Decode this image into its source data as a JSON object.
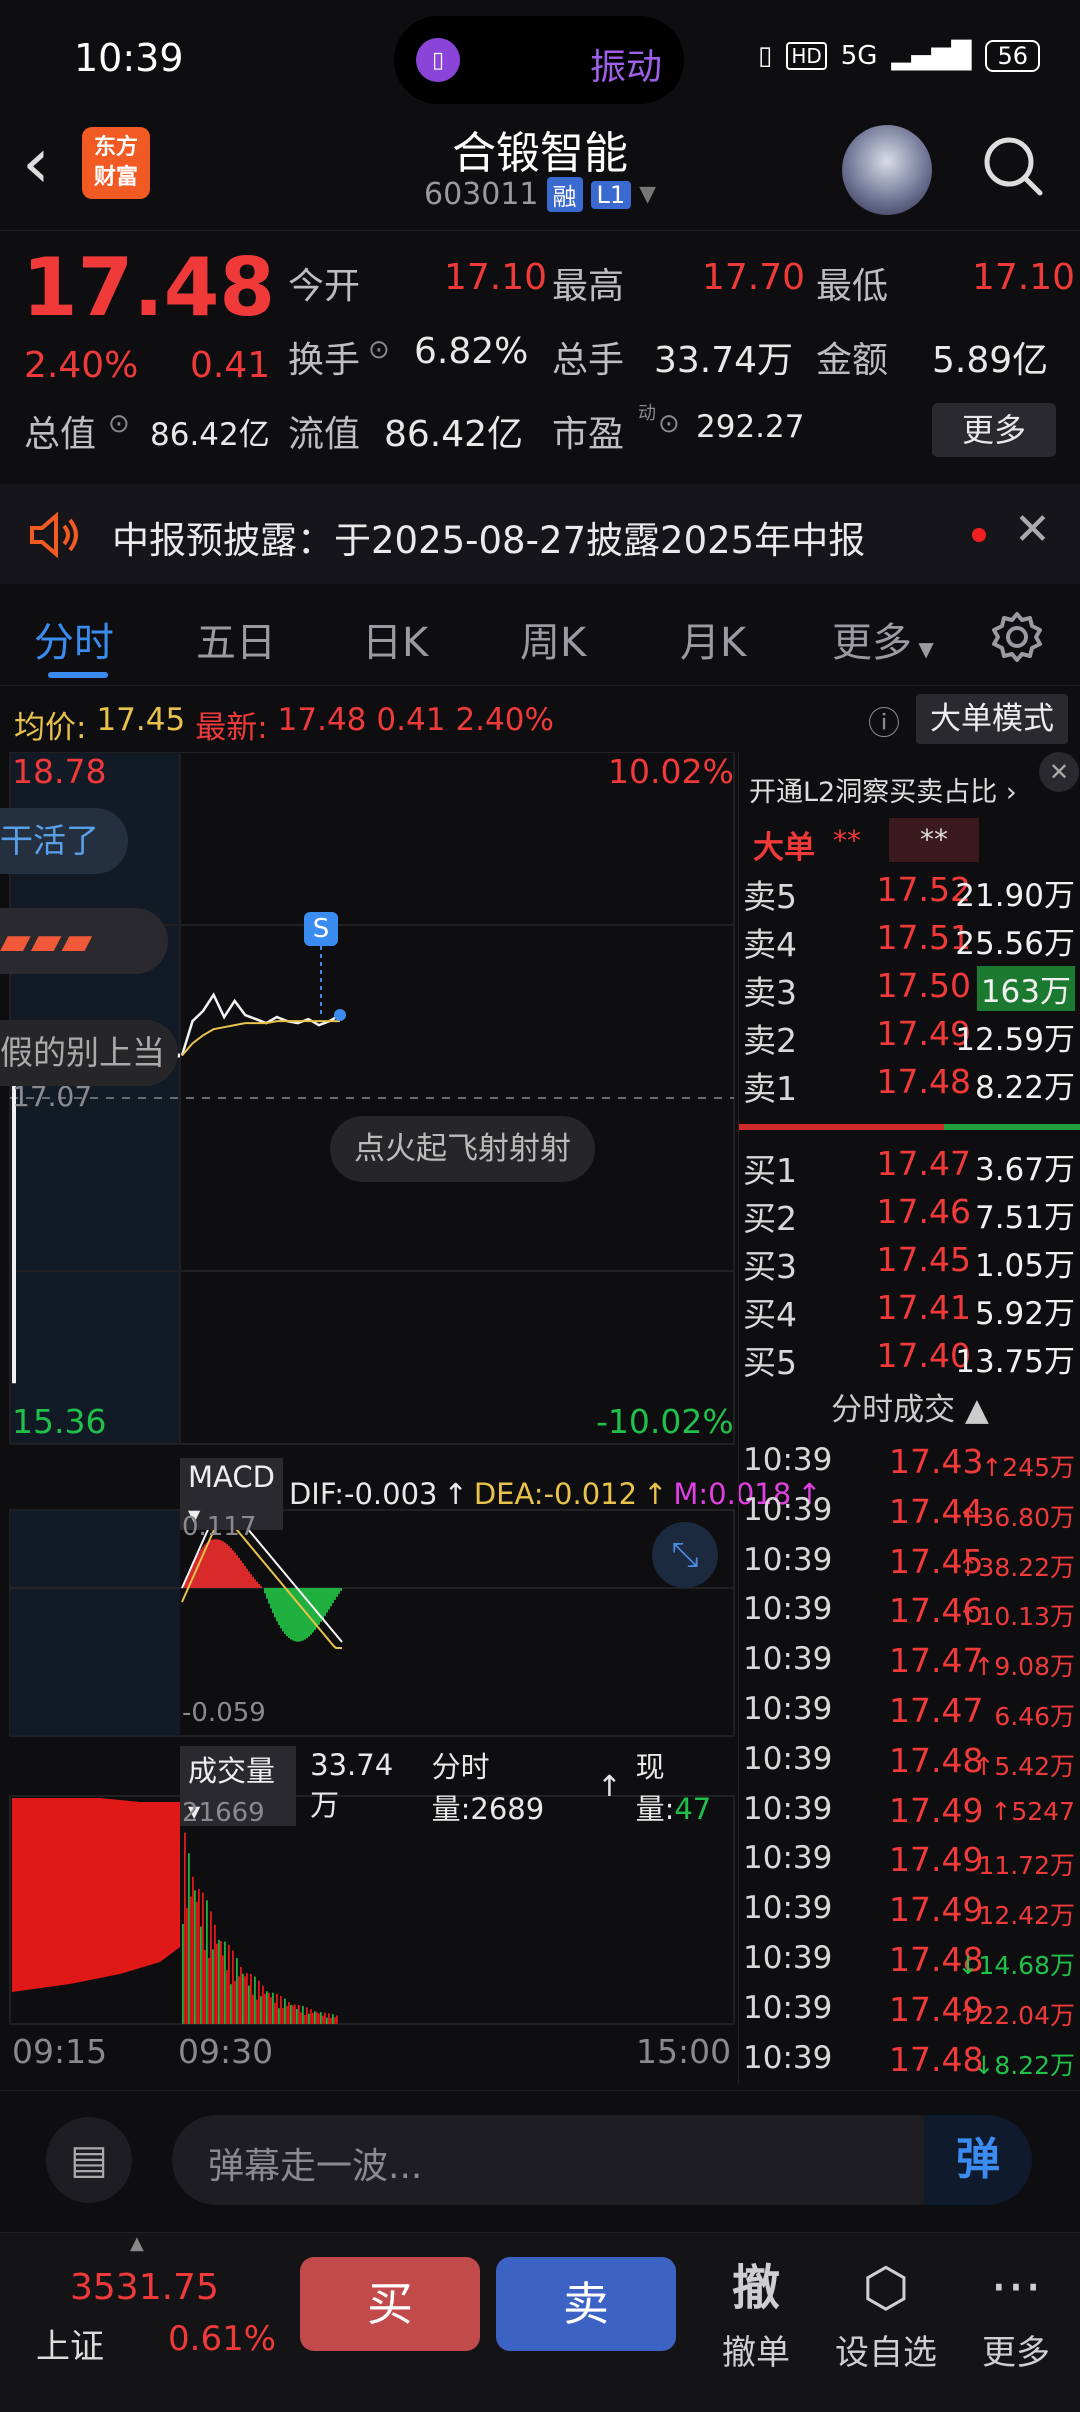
{
  "status": {
    "time": "10:39",
    "vibrate": "振动",
    "network": "5G",
    "battery": "56"
  },
  "header": {
    "logo_line1": "东方",
    "logo_line2": "财富",
    "name": "合锻智能",
    "code": "603011",
    "tag_margin": "融",
    "tag_level": "L1"
  },
  "quote": {
    "price": "17.48",
    "pct": "2.40%",
    "change": "0.41",
    "open_label": "今开",
    "open": "17.10",
    "high_label": "最高",
    "high": "17.70",
    "low_label": "最低",
    "low": "17.10",
    "turnover_label": "换手",
    "turnover": "6.82%",
    "volume_label": "总手",
    "volume": "33.74万",
    "amount_label": "金额",
    "amount": "5.89亿",
    "mcap_label": "总值",
    "mcap": "86.42亿",
    "float_label": "流值",
    "float": "86.42亿",
    "pe_label": "市盈",
    "pe_sup": "动",
    "pe": "292.27",
    "more": "更多"
  },
  "notice": {
    "text": "中报预披露：于2025-08-27披露2025年中报"
  },
  "tabs": [
    "分时",
    "五日",
    "日K",
    "周K",
    "月K",
    "更多"
  ],
  "infoline": {
    "avg_label": "均价:",
    "avg": "17.45",
    "latest_label": "最新:",
    "latest": "17.48",
    "change": "0.41",
    "pct": "2.40%",
    "mode": "大单模式"
  },
  "chart": {
    "y_top": "18.78",
    "y_mid": "17.07",
    "y_bot": "15.36",
    "pct_top": "10.02%",
    "pct_bot": "-10.02%",
    "danmu1": "干活了",
    "danmu3": "假的别上当",
    "danmu4": "点火起飞射射射",
    "marker": "S",
    "macd_label": "MACD",
    "dif": "DIF:-0.003",
    "dea": "DEA:-0.012",
    "m": "M:0.018",
    "macd_top": "0.117",
    "macd_bot": "-0.059",
    "vol_label": "成交量",
    "vol_total": "33.74万",
    "vol_period": "分时量:2689",
    "vol_now": "现量:47",
    "vol_max": "21669",
    "t_start": "09:15",
    "t_open": "09:30",
    "t_end": "15:00"
  },
  "chart_data": {
    "type": "line",
    "title": "",
    "x": [
      "09:30",
      "09:31",
      "09:32",
      "09:33",
      "09:34",
      "09:35",
      "09:36",
      "09:37",
      "09:38",
      "09:39",
      "09:40",
      "09:41",
      "09:42",
      "09:43",
      "09:44",
      "09:45"
    ],
    "series": [
      {
        "name": "最新",
        "values": [
          17.28,
          17.45,
          17.5,
          17.58,
          17.47,
          17.55,
          17.48,
          17.46,
          17.44,
          17.47,
          17.45,
          17.44,
          17.46,
          17.43,
          17.45,
          17.48
        ]
      },
      {
        "name": "均价",
        "values": [
          17.28,
          17.34,
          17.38,
          17.41,
          17.42,
          17.43,
          17.44,
          17.44,
          17.44,
          17.45,
          17.45,
          17.45,
          17.45,
          17.45,
          17.45,
          17.45
        ]
      }
    ],
    "ylim": [
      15.36,
      18.78
    ],
    "xlabel": "",
    "ylabel": ""
  },
  "book": {
    "l2": "开通L2洞察买卖占比",
    "big_label": "大单",
    "sells": [
      {
        "label": "卖5",
        "price": "17.52",
        "vol": "21.90万"
      },
      {
        "label": "卖4",
        "price": "17.51",
        "vol": "25.56万"
      },
      {
        "label": "卖3",
        "price": "17.50",
        "vol": "163万"
      },
      {
        "label": "卖2",
        "price": "17.49",
        "vol": "12.59万"
      },
      {
        "label": "卖1",
        "price": "17.48",
        "vol": "8.22万"
      }
    ],
    "buys": [
      {
        "label": "买1",
        "price": "17.47",
        "vol": "3.67万"
      },
      {
        "label": "买2",
        "price": "17.46",
        "vol": "7.51万"
      },
      {
        "label": "买3",
        "price": "17.45",
        "vol": "1.05万"
      },
      {
        "label": "买4",
        "price": "17.41",
        "vol": "5.92万"
      },
      {
        "label": "买5",
        "price": "17.40",
        "vol": "13.75万"
      }
    ],
    "trades_title": "分时成交",
    "trades": [
      {
        "t": "10:39",
        "p": "17.43",
        "v": "↑245万",
        "c": "red"
      },
      {
        "t": "10:39",
        "p": "17.44",
        "v": "↑36.80万",
        "c": "red"
      },
      {
        "t": "10:39",
        "p": "17.45",
        "v": "↑38.22万",
        "c": "red"
      },
      {
        "t": "10:39",
        "p": "17.46",
        "v": "↑10.13万",
        "c": "red"
      },
      {
        "t": "10:39",
        "p": "17.47",
        "v": "↑9.08万",
        "c": "red"
      },
      {
        "t": "10:39",
        "p": "17.47",
        "v": "6.46万",
        "c": "red"
      },
      {
        "t": "10:39",
        "p": "17.48",
        "v": "↑5.42万",
        "c": "red"
      },
      {
        "t": "10:39",
        "p": "17.49",
        "v": "↑5247",
        "c": "red"
      },
      {
        "t": "10:39",
        "p": "17.49",
        "v": "11.72万",
        "c": "red"
      },
      {
        "t": "10:39",
        "p": "17.49",
        "v": "12.42万",
        "c": "red"
      },
      {
        "t": "10:39",
        "p": "17.48",
        "v": "↓14.68万",
        "c": "green"
      },
      {
        "t": "10:39",
        "p": "17.49",
        "v": "↑22.04万",
        "c": "red"
      },
      {
        "t": "10:39",
        "p": "17.48",
        "v": "↓8.22万",
        "c": "green"
      }
    ]
  },
  "comment": {
    "placeholder": "弹幕走一波...",
    "danmu_btn": "弹"
  },
  "bottom": {
    "index_value": "3531.75",
    "index_name": "上证",
    "index_pct": "0.61%",
    "buy": "买",
    "sell": "卖",
    "cancel": "撤单",
    "cancel_icon": "撤",
    "watchlist": "设自选",
    "more": "更多"
  },
  "colors": {
    "up": "#f03a3a",
    "down": "#20c04a",
    "accent": "#3b8cf0",
    "brand": "#f25a23"
  }
}
